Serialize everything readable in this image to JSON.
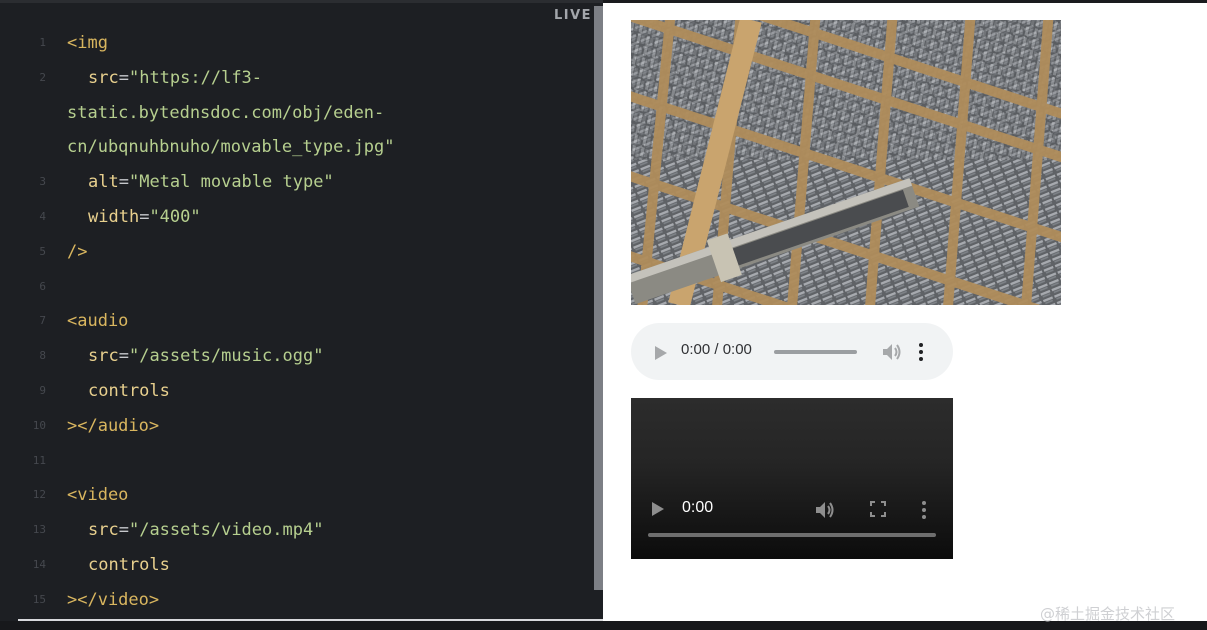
{
  "editor": {
    "live_label": "LIVE",
    "lines": [
      {
        "n": "1",
        "segments": [
          {
            "t": "tag",
            "v": "<img"
          }
        ]
      },
      {
        "n": "2",
        "indent": true,
        "segments": [
          {
            "t": "attr",
            "v": "src"
          },
          {
            "t": "eq",
            "v": "="
          },
          {
            "t": "str",
            "v": "\"https://lf3-"
          }
        ]
      },
      {
        "n": "",
        "segments": [
          {
            "t": "str",
            "v": "static.bytednsdoc.com/obj/eden-"
          }
        ]
      },
      {
        "n": "",
        "segments": [
          {
            "t": "str",
            "v": "cn/ubqnuhbnuho/movable_type.jpg\""
          }
        ]
      },
      {
        "n": "3",
        "indent": true,
        "segments": [
          {
            "t": "attr",
            "v": "alt"
          },
          {
            "t": "eq",
            "v": "="
          },
          {
            "t": "str",
            "v": "\"Metal movable type\""
          }
        ]
      },
      {
        "n": "4",
        "indent": true,
        "segments": [
          {
            "t": "attr",
            "v": "width"
          },
          {
            "t": "eq",
            "v": "="
          },
          {
            "t": "str",
            "v": "\"400\""
          }
        ]
      },
      {
        "n": "5",
        "segments": [
          {
            "t": "tag",
            "v": "/>"
          }
        ]
      },
      {
        "n": "6",
        "segments": []
      },
      {
        "n": "7",
        "segments": [
          {
            "t": "tag",
            "v": "<audio"
          }
        ]
      },
      {
        "n": "8",
        "indent": true,
        "segments": [
          {
            "t": "attr",
            "v": "src"
          },
          {
            "t": "eq",
            "v": "="
          },
          {
            "t": "str",
            "v": "\"/assets/music.ogg\""
          }
        ]
      },
      {
        "n": "9",
        "indent": true,
        "segments": [
          {
            "t": "attr",
            "v": "controls"
          }
        ]
      },
      {
        "n": "10",
        "segments": [
          {
            "t": "tag",
            "v": "></audio>"
          }
        ]
      },
      {
        "n": "11",
        "segments": []
      },
      {
        "n": "12",
        "segments": [
          {
            "t": "tag",
            "v": "<video"
          }
        ]
      },
      {
        "n": "13",
        "indent": true,
        "segments": [
          {
            "t": "attr",
            "v": "src"
          },
          {
            "t": "eq",
            "v": "="
          },
          {
            "t": "str",
            "v": "\"/assets/video.mp4\""
          }
        ]
      },
      {
        "n": "14",
        "indent": true,
        "segments": [
          {
            "t": "attr",
            "v": "controls"
          }
        ]
      },
      {
        "n": "15",
        "segments": [
          {
            "t": "tag",
            "v": "></video>"
          }
        ]
      }
    ]
  },
  "preview": {
    "audio": {
      "time": "0:00 / 0:00"
    },
    "video": {
      "time": "0:00"
    }
  },
  "colors": {
    "tag": "#d9b65f",
    "attr": "#e8d08e",
    "string": "#b6cf8f",
    "editor_bg": "#1d1f23"
  },
  "watermark": "@稀土掘金技术社区"
}
